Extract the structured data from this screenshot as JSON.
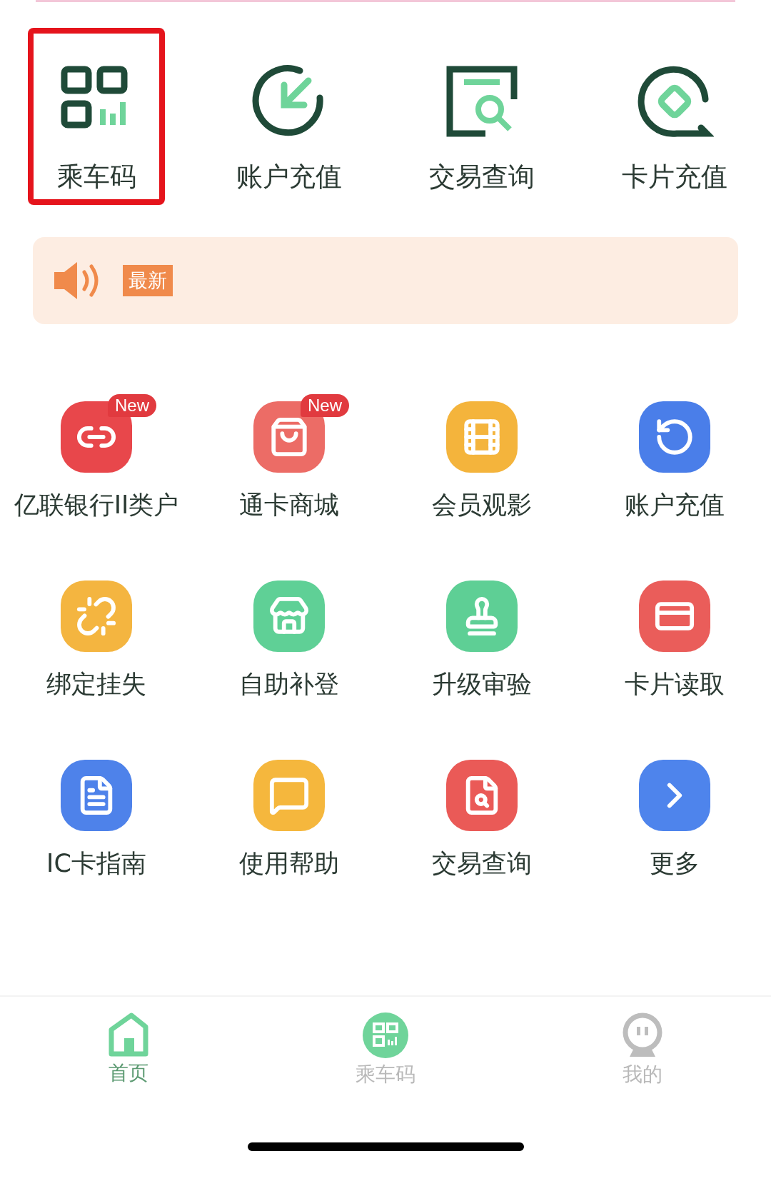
{
  "quick_actions": [
    {
      "label": "乘车码",
      "highlighted": true
    },
    {
      "label": "账户充值",
      "highlighted": false
    },
    {
      "label": "交易查询",
      "highlighted": false
    },
    {
      "label": "卡片充值",
      "highlighted": false
    }
  ],
  "notice": {
    "badge": "最新"
  },
  "services": [
    {
      "label": "亿联银行II类户",
      "color": "#e8474b",
      "badge": "New"
    },
    {
      "label": "通卡商城",
      "color": "#ec6c66",
      "badge": "New"
    },
    {
      "label": "会员观影",
      "color": "#f4b43c"
    },
    {
      "label": "账户充值",
      "color": "#4a7ee9"
    },
    {
      "label": "绑定挂失",
      "color": "#f4b540"
    },
    {
      "label": "自助补登",
      "color": "#5fd096"
    },
    {
      "label": "升级审验",
      "color": "#5ecf95"
    },
    {
      "label": "卡片读取",
      "color": "#ea5d5a"
    },
    {
      "label": "IC卡指南",
      "color": "#4e82ea"
    },
    {
      "label": "使用帮助",
      "color": "#f5b73d"
    },
    {
      "label": "交易查询",
      "color": "#ea5a57"
    },
    {
      "label": "更多",
      "color": "#4e84ec"
    }
  ],
  "tab_bar": [
    {
      "label": "首页",
      "selected": true
    },
    {
      "label": "乘车码",
      "selected": false
    },
    {
      "label": "我的",
      "selected": false
    }
  ]
}
